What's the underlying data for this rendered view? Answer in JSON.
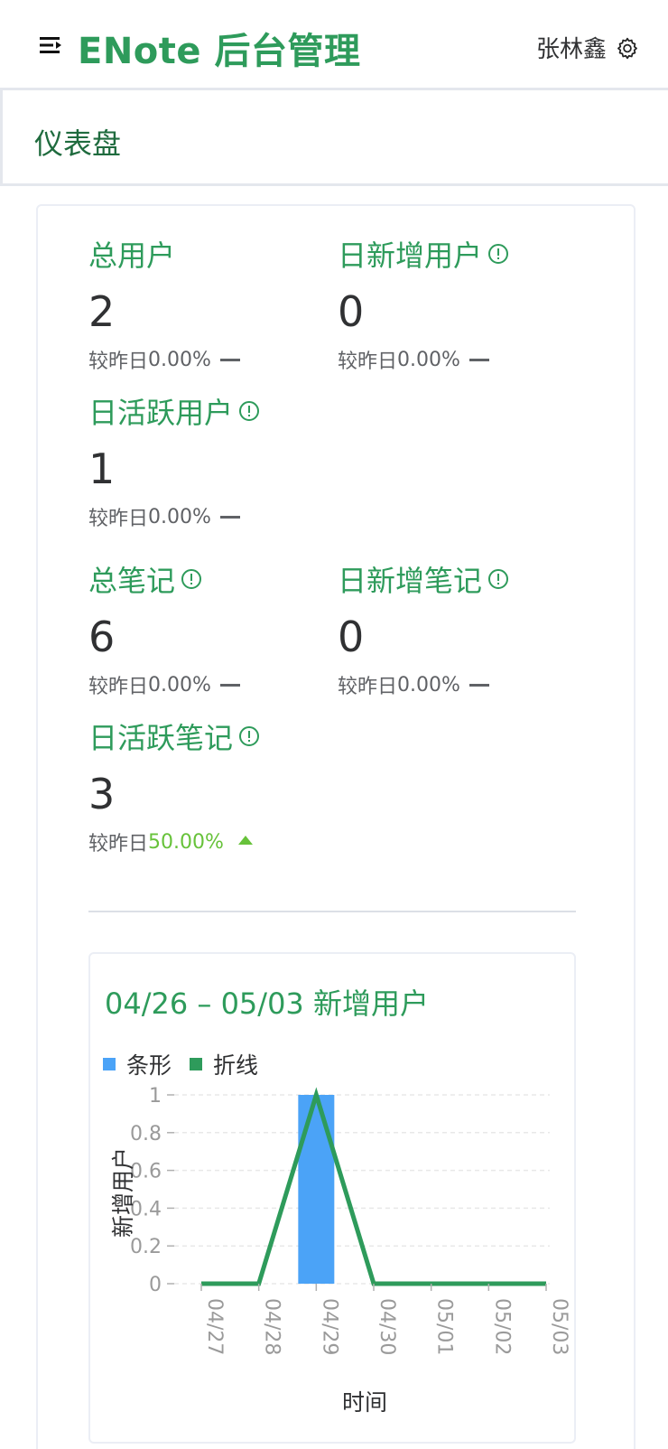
{
  "header": {
    "title": "ENote 后台管理",
    "user_name": "张林鑫"
  },
  "page": {
    "title": "仪表盘"
  },
  "stats": {
    "total_users": {
      "label": "总用户",
      "value": "2",
      "compare_prefix": "较昨日",
      "compare_pct": "0.00%",
      "trend": "flat"
    },
    "new_users": {
      "label": "日新增用户",
      "value": "0",
      "compare_prefix": "较昨日",
      "compare_pct": "0.00%",
      "trend": "flat"
    },
    "active_users": {
      "label": "日活跃用户",
      "value": "1",
      "compare_prefix": "较昨日",
      "compare_pct": "0.00%",
      "trend": "flat"
    },
    "total_notes": {
      "label": "总笔记",
      "value": "6",
      "compare_prefix": "较昨日",
      "compare_pct": "0.00%",
      "trend": "flat"
    },
    "new_notes": {
      "label": "日新增笔记",
      "value": "0",
      "compare_prefix": "较昨日",
      "compare_pct": "0.00%",
      "trend": "flat"
    },
    "active_notes": {
      "label": "日活跃笔记",
      "value": "3",
      "compare_prefix": "较昨日",
      "compare_pct": "50.00%",
      "trend": "up"
    }
  },
  "colors": {
    "accent": "#2e9b5b",
    "bar": "#4ba3f7",
    "line": "#2e9b5b",
    "up": "#67c23a"
  },
  "chart_data": {
    "type": "bar",
    "title": "04/26 – 05/03 新增用户",
    "categories": [
      "04/27",
      "04/28",
      "04/29",
      "04/30",
      "05/01",
      "05/02",
      "05/03"
    ],
    "series": [
      {
        "name": "条形",
        "type": "bar",
        "values": [
          0,
          0,
          1,
          0,
          0,
          0,
          0
        ]
      },
      {
        "name": "折线",
        "type": "line",
        "values": [
          0,
          0,
          1,
          0,
          0,
          0,
          0
        ]
      }
    ],
    "xlabel": "时间",
    "ylabel": "新增用户",
    "ylim": [
      0,
      1
    ],
    "yticks": [
      "0",
      "0.2",
      "0.4",
      "0.6",
      "0.8",
      "1"
    ],
    "grid": true,
    "legend": "top-left"
  }
}
